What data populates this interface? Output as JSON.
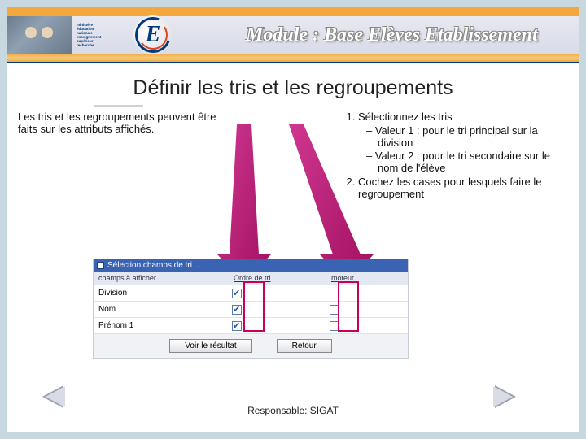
{
  "banner": {
    "module_label": "Module : Base Elèves Etablissement",
    "e_letter": "E",
    "ministry_lines": [
      "ministère",
      "éducation",
      "nationale",
      "enseignement",
      "supérieur",
      "recherche"
    ]
  },
  "title": "Définir les tris et les regroupements",
  "intro": "Les tris et les regroupements peuvent être faits sur les attributs affichés.",
  "steps": {
    "item1": "Sélectionnez les tris",
    "sub1": "Valeur 1 : pour le tri principal sur la division",
    "sub2": "Valeur 2 : pour le tri secondaire sur le nom de l'élève",
    "item2": "Cochez les cases pour lesquels faire le regroupement"
  },
  "shot": {
    "header": "Sélection champs de tri ...",
    "col_label": "champs à afficher",
    "col_order": "Ordre de tri",
    "col_group": "moteur",
    "rows": [
      {
        "label": "Division",
        "checked": true
      },
      {
        "label": "Nom",
        "checked": true
      },
      {
        "label": "Prénom 1",
        "checked": true
      }
    ],
    "btn_view": "Voir le résultat",
    "btn_back": "Retour"
  },
  "footer": "Responsable: SIGAT"
}
